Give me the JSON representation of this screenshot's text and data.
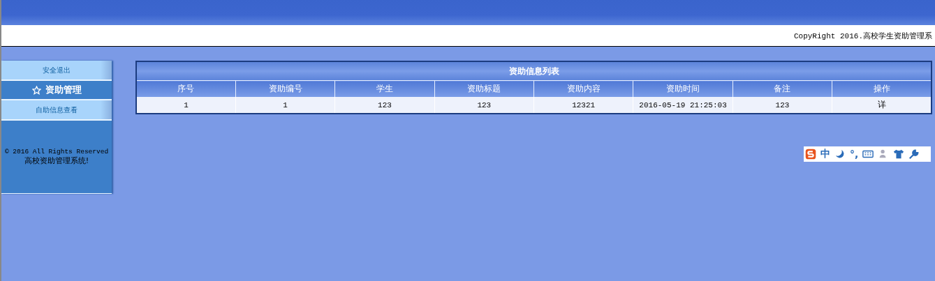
{
  "header": {
    "copyright": "CopyRight 2016.高校学生资助管理系"
  },
  "sidebar": {
    "items": [
      {
        "kind": "link",
        "label": "安全退出"
      },
      {
        "kind": "heading",
        "label": "资助管理"
      },
      {
        "kind": "link",
        "label": "自助信息查看"
      }
    ],
    "footer": [
      "© 2016 All Rights Reserved",
      "高校资助管理系统!"
    ]
  },
  "table": {
    "title": "资助信息列表",
    "columns": [
      "序号",
      "资助编号",
      "学生",
      "资助标题",
      "资助内容",
      "资助时间",
      "备注",
      "操作"
    ],
    "rows": [
      {
        "cells": [
          "1",
          "1",
          "123",
          "123",
          "12321",
          "2016-05-19 21:25:03",
          "123"
        ],
        "action": "详"
      }
    ]
  },
  "ime_toolbar": {
    "mode": "中",
    "punctuation": "°,"
  }
}
